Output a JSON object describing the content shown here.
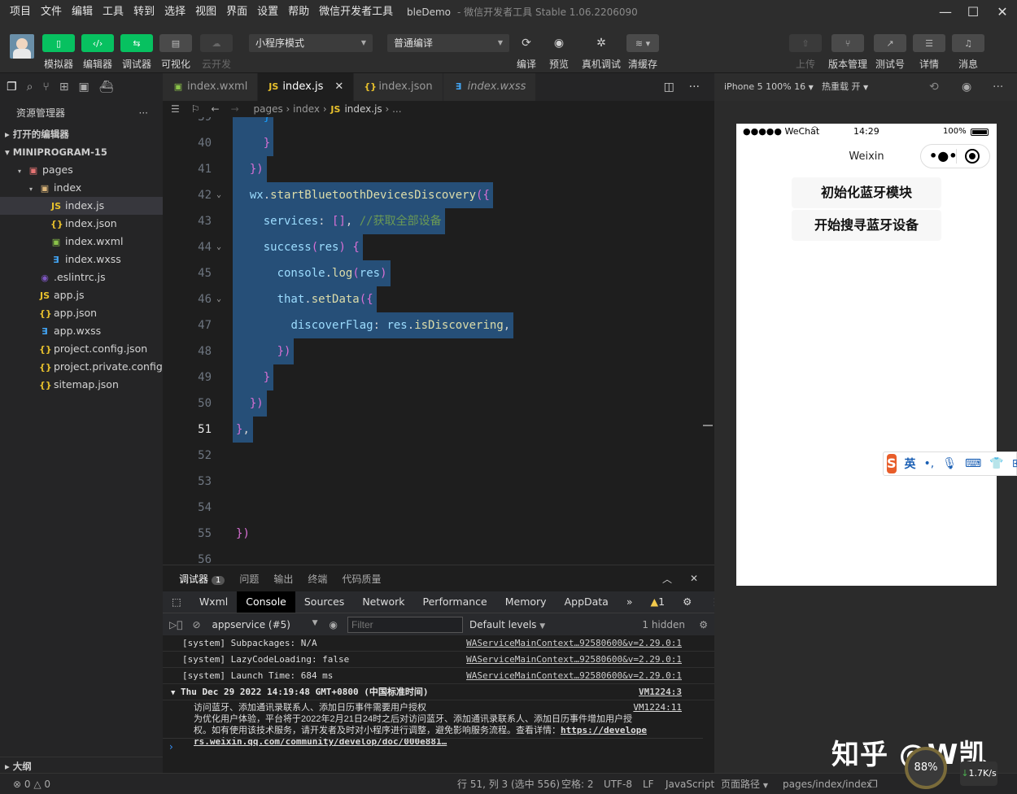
{
  "menubar": {
    "items": [
      "项目",
      "文件",
      "编辑",
      "工具",
      "转到",
      "选择",
      "视图",
      "界面",
      "设置",
      "帮助",
      "微信开发者工具"
    ],
    "title": "bleDemo",
    "subtitle": "- 微信开发者工具 Stable 1.06.2206090"
  },
  "toolbar": {
    "simulator": "模拟器",
    "editor": "编辑器",
    "debugger": "调试器",
    "visual": "可视化",
    "cloud": "云开发",
    "mode": "小程序模式",
    "compile_mode": "普通编译",
    "compile": "编译",
    "preview": "预览",
    "remote_debug": "真机调试",
    "clear_cache": "清缓存",
    "upload": "上传",
    "version": "版本管理",
    "test": "测试号",
    "details": "详情",
    "messages": "消息"
  },
  "sidebar": {
    "title": "资源管理器",
    "open_editors": "打开的编辑器",
    "project": "MINIPROGRAM-15",
    "tree": [
      {
        "label": "pages",
        "level": 1,
        "icon": "folder-pages",
        "twist": "▾"
      },
      {
        "label": "index",
        "level": 2,
        "icon": "folder",
        "twist": "▾"
      },
      {
        "label": "index.js",
        "level": 3,
        "icon": "js"
      },
      {
        "label": "index.json",
        "level": 3,
        "icon": "json"
      },
      {
        "label": "index.wxml",
        "level": 3,
        "icon": "wxml"
      },
      {
        "label": "index.wxss",
        "level": 3,
        "icon": "wxss"
      },
      {
        "label": ".eslintrc.js",
        "level": 2,
        "icon": "eslint"
      },
      {
        "label": "app.js",
        "level": 2,
        "icon": "js"
      },
      {
        "label": "app.json",
        "level": 2,
        "icon": "json"
      },
      {
        "label": "app.wxss",
        "level": 2,
        "icon": "wxss"
      },
      {
        "label": "project.config.json",
        "level": 2,
        "icon": "json"
      },
      {
        "label": "project.private.config.js...",
        "level": 2,
        "icon": "json"
      },
      {
        "label": "sitemap.json",
        "level": 2,
        "icon": "json"
      }
    ],
    "outline": "大纲"
  },
  "tabs": [
    {
      "label": "index.wxml",
      "icon": "wxml"
    },
    {
      "label": "index.js",
      "icon": "js",
      "active": true
    },
    {
      "label": "index.json",
      "icon": "json"
    },
    {
      "label": "index.wxss",
      "icon": "wxss"
    }
  ],
  "breadcrumb": {
    "pages": "pages",
    "index": "index",
    "file": "index.js",
    "more": "..."
  },
  "editor": {
    "lines": [
      {
        "n": "40",
        "text": "    }"
      },
      {
        "n": "41",
        "text": "  })"
      },
      {
        "n": "42",
        "text": "  wx.startBluetoothDevicesDiscovery({"
      },
      {
        "n": "43",
        "text": "    services: [], //获取全部设备"
      },
      {
        "n": "44",
        "text": "    success(res) {"
      },
      {
        "n": "45",
        "text": "      console.log(res)"
      },
      {
        "n": "46",
        "text": "      that.setData({"
      },
      {
        "n": "47",
        "text": "        discoverFlag: res.isDiscovering,"
      },
      {
        "n": "48",
        "text": "      })"
      },
      {
        "n": "49",
        "text": "    }"
      },
      {
        "n": "50",
        "text": "  })"
      },
      {
        "n": "51",
        "text": "},"
      },
      {
        "n": "52",
        "text": ""
      },
      {
        "n": "53",
        "text": ""
      },
      {
        "n": "54",
        "text": ""
      },
      {
        "n": "55",
        "text": "})"
      },
      {
        "n": "56",
        "text": ""
      }
    ]
  },
  "panel": {
    "tabs": [
      "调试器",
      "问题",
      "输出",
      "终端",
      "代码质量"
    ],
    "badge": "1",
    "devtools": [
      "Wxml",
      "Console",
      "Sources",
      "Network",
      "Performance",
      "Memory",
      "AppData"
    ],
    "warn_count": "1",
    "context": "appservice (#5)",
    "filter_placeholder": "Filter",
    "levels": "Default levels",
    "hidden": "1 hidden",
    "console": [
      {
        "text": "[system] Subpackages: N/A",
        "src": "WAServiceMainContext…92580600&v=2.29.0:1"
      },
      {
        "text": "[system] LazyCodeLoading: false",
        "src": "WAServiceMainContext…92580600&v=2.29.0:1"
      },
      {
        "text": "[system] Launch Time: 684 ms",
        "src": "WAServiceMainContext…92580600&v=2.29.0:1"
      }
    ],
    "group_title": "Thu Dec 29 2022 14:19:48 GMT+0800 (中国标准时间)",
    "group_src": "VM1224:3",
    "msg_line1": "访问蓝牙、添加通讯录联系人、添加日历事件需要用户授权",
    "msg_src": "VM1224:11",
    "msg_line2": "为优化用户体验，平台将于2022年2月21日24时之后对访问蓝牙、添加通讯录联系人、添加日历事件增加用户授",
    "msg_line3": "权。如有使用该技术服务，请开发者及时对小程序进行调整，避免影响服务流程。查看详情：",
    "msg_link1": "https://develope",
    "msg_link2": "rs.weixin.qq.com/community/develop/doc/000e881…"
  },
  "status": {
    "errors": "0",
    "warnings": "0",
    "position": "行 51, 列 3 (选中 556)",
    "spaces": "空格: 2",
    "encoding": "UTF-8",
    "eol": "LF",
    "language": "JavaScript",
    "page_path_label": "页面路径",
    "page_path": "pages/index/index"
  },
  "simulator": {
    "device": "iPhone 5 100% 16",
    "hot_reload": "热重载 开",
    "carrier": "●●●●● WeChat",
    "time": "14:29",
    "battery": "100%",
    "nav_title": "Weixin",
    "btn_init": "初始化蓝牙模块",
    "btn_search": "开始搜寻蓝牙设备"
  },
  "ime": {
    "lang": "英"
  },
  "overlay": {
    "watermark": "知乎 @W凯",
    "meter": "88%",
    "speed": "1.7K/s"
  },
  "colors": {
    "accent_green": "#07c160",
    "selection": "#264f78",
    "editor_bg": "#1e1e1e"
  }
}
